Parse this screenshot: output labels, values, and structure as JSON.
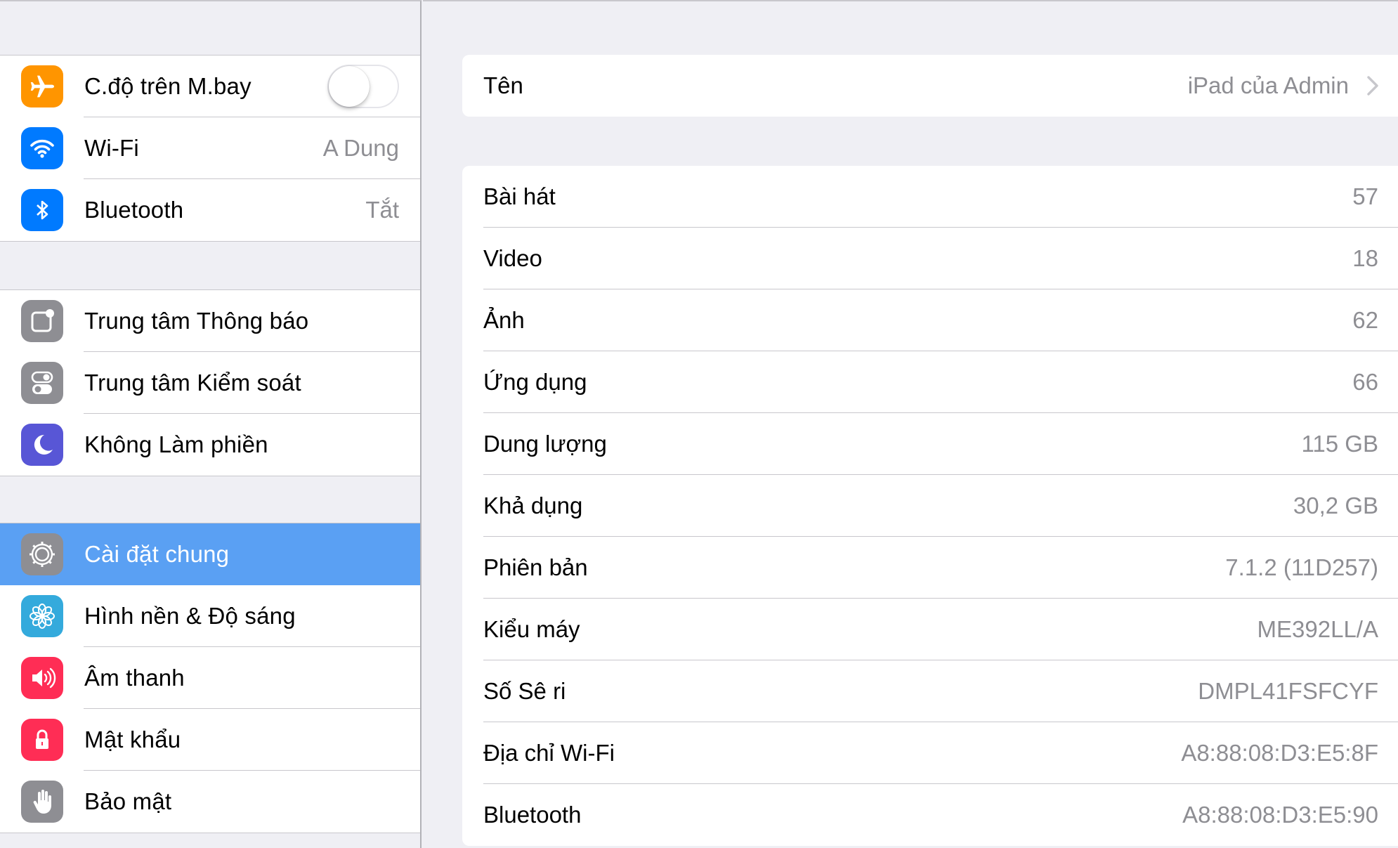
{
  "sidebar": {
    "group1": [
      {
        "label": "C.độ trên M.bay",
        "icon": "airplane-icon",
        "color": "#ff9500",
        "toggle": false
      },
      {
        "label": "Wi-Fi",
        "value": "A Dung",
        "icon": "wifi-icon",
        "color": "#007aff"
      },
      {
        "label": "Bluetooth",
        "value": "Tắt",
        "icon": "bluetooth-icon",
        "color": "#007aff"
      }
    ],
    "group2": [
      {
        "label": "Trung tâm Thông báo",
        "icon": "notification-center-icon",
        "color": "#8e8e93"
      },
      {
        "label": "Trung tâm Kiểm soát",
        "icon": "control-center-icon",
        "color": "#8e8e93"
      },
      {
        "label": "Không Làm phiền",
        "icon": "moon-icon",
        "color": "#5856d6"
      }
    ],
    "group3": [
      {
        "label": "Cài đặt chung",
        "icon": "gear-icon",
        "color": "#8e8e93",
        "selected": true
      },
      {
        "label": "Hình nền & Độ sáng",
        "icon": "wallpaper-flower-icon",
        "color": "#34aadc"
      },
      {
        "label": "Âm thanh",
        "icon": "speaker-icon",
        "color": "#ff2d55"
      },
      {
        "label": "Mật khẩu",
        "icon": "lock-icon",
        "color": "#ff2d55"
      },
      {
        "label": "Bảo mật",
        "icon": "hand-icon",
        "color": "#8e8e93"
      }
    ],
    "selected_color": "#5aa0f3"
  },
  "detail": {
    "name_row": {
      "label": "Tên",
      "value": "iPad của Admin"
    },
    "rows": [
      {
        "label": "Bài hát",
        "value": "57"
      },
      {
        "label": "Video",
        "value": "18"
      },
      {
        "label": "Ảnh",
        "value": "62"
      },
      {
        "label": "Ứng dụng",
        "value": "66"
      },
      {
        "label": "Dung lượng",
        "value": "115 GB"
      },
      {
        "label": "Khả dụng",
        "value": "30,2 GB"
      },
      {
        "label": "Phiên bản",
        "value": "7.1.2 (11D257)"
      },
      {
        "label": "Kiểu máy",
        "value": "ME392LL/A"
      },
      {
        "label": "Số Sê ri",
        "value": "DMPL41FSFCYF"
      },
      {
        "label": "Địa chỉ Wi-Fi",
        "value": "A8:88:08:D3:E5:8F"
      },
      {
        "label": "Bluetooth",
        "value": "A8:88:08:D3:E5:90"
      }
    ]
  }
}
